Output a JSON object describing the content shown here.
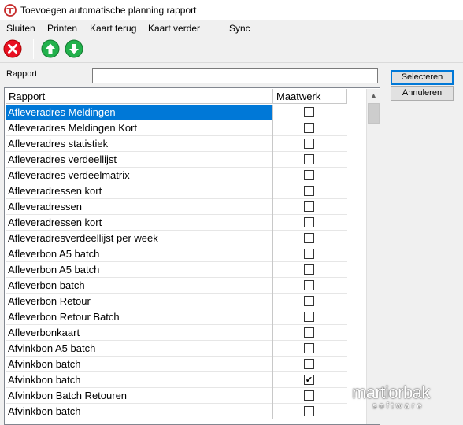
{
  "window": {
    "title": "Toevoegen automatische planning rapport"
  },
  "menu": [
    "Sluiten",
    "Printen",
    "Kaart terug",
    "Kaart verder",
    "Sync"
  ],
  "toolbar": {
    "close_icon": "close-icon",
    "up_icon": "arrow-up-icon",
    "down_icon": "arrow-down-icon",
    "close_color": "#e81123",
    "nav_color": "#22b14c"
  },
  "form": {
    "label": "Rapport",
    "value": "",
    "placeholder": ""
  },
  "buttons": {
    "select": "Selecteren",
    "cancel": "Annuleren"
  },
  "grid": {
    "columns": [
      "Rapport",
      "Maatwerk"
    ],
    "rows": [
      {
        "name": "Afleveradres Meldingen",
        "maatwerk": false,
        "selected": true
      },
      {
        "name": "Afleveradres Meldingen Kort",
        "maatwerk": false
      },
      {
        "name": "Afleveradres statistiek",
        "maatwerk": false
      },
      {
        "name": "Afleveradres verdeellijst",
        "maatwerk": false
      },
      {
        "name": "Afleveradres verdeelmatrix",
        "maatwerk": false
      },
      {
        "name": "Afleveradressen kort",
        "maatwerk": false
      },
      {
        "name": "Afleveradressen",
        "maatwerk": false
      },
      {
        "name": "Afleveradressen kort",
        "maatwerk": false
      },
      {
        "name": "Afleveradresverdeellijst per week",
        "maatwerk": false
      },
      {
        "name": "Afleverbon A5 batch",
        "maatwerk": false
      },
      {
        "name": "Afleverbon A5 batch",
        "maatwerk": false
      },
      {
        "name": "Afleverbon batch",
        "maatwerk": false
      },
      {
        "name": "Afleverbon Retour",
        "maatwerk": false
      },
      {
        "name": "Afleverbon Retour Batch",
        "maatwerk": false
      },
      {
        "name": "Afleverbonkaart",
        "maatwerk": false
      },
      {
        "name": "Afvinkbon A5 batch",
        "maatwerk": false
      },
      {
        "name": "Afvinkbon batch",
        "maatwerk": false
      },
      {
        "name": "Afvinkbon batch",
        "maatwerk": true
      },
      {
        "name": "Afvinkbon Batch Retouren",
        "maatwerk": false
      },
      {
        "name": "Afvinkbon batch",
        "maatwerk": false
      }
    ]
  },
  "watermark": {
    "main": "martiorbak",
    "sub": "software"
  }
}
